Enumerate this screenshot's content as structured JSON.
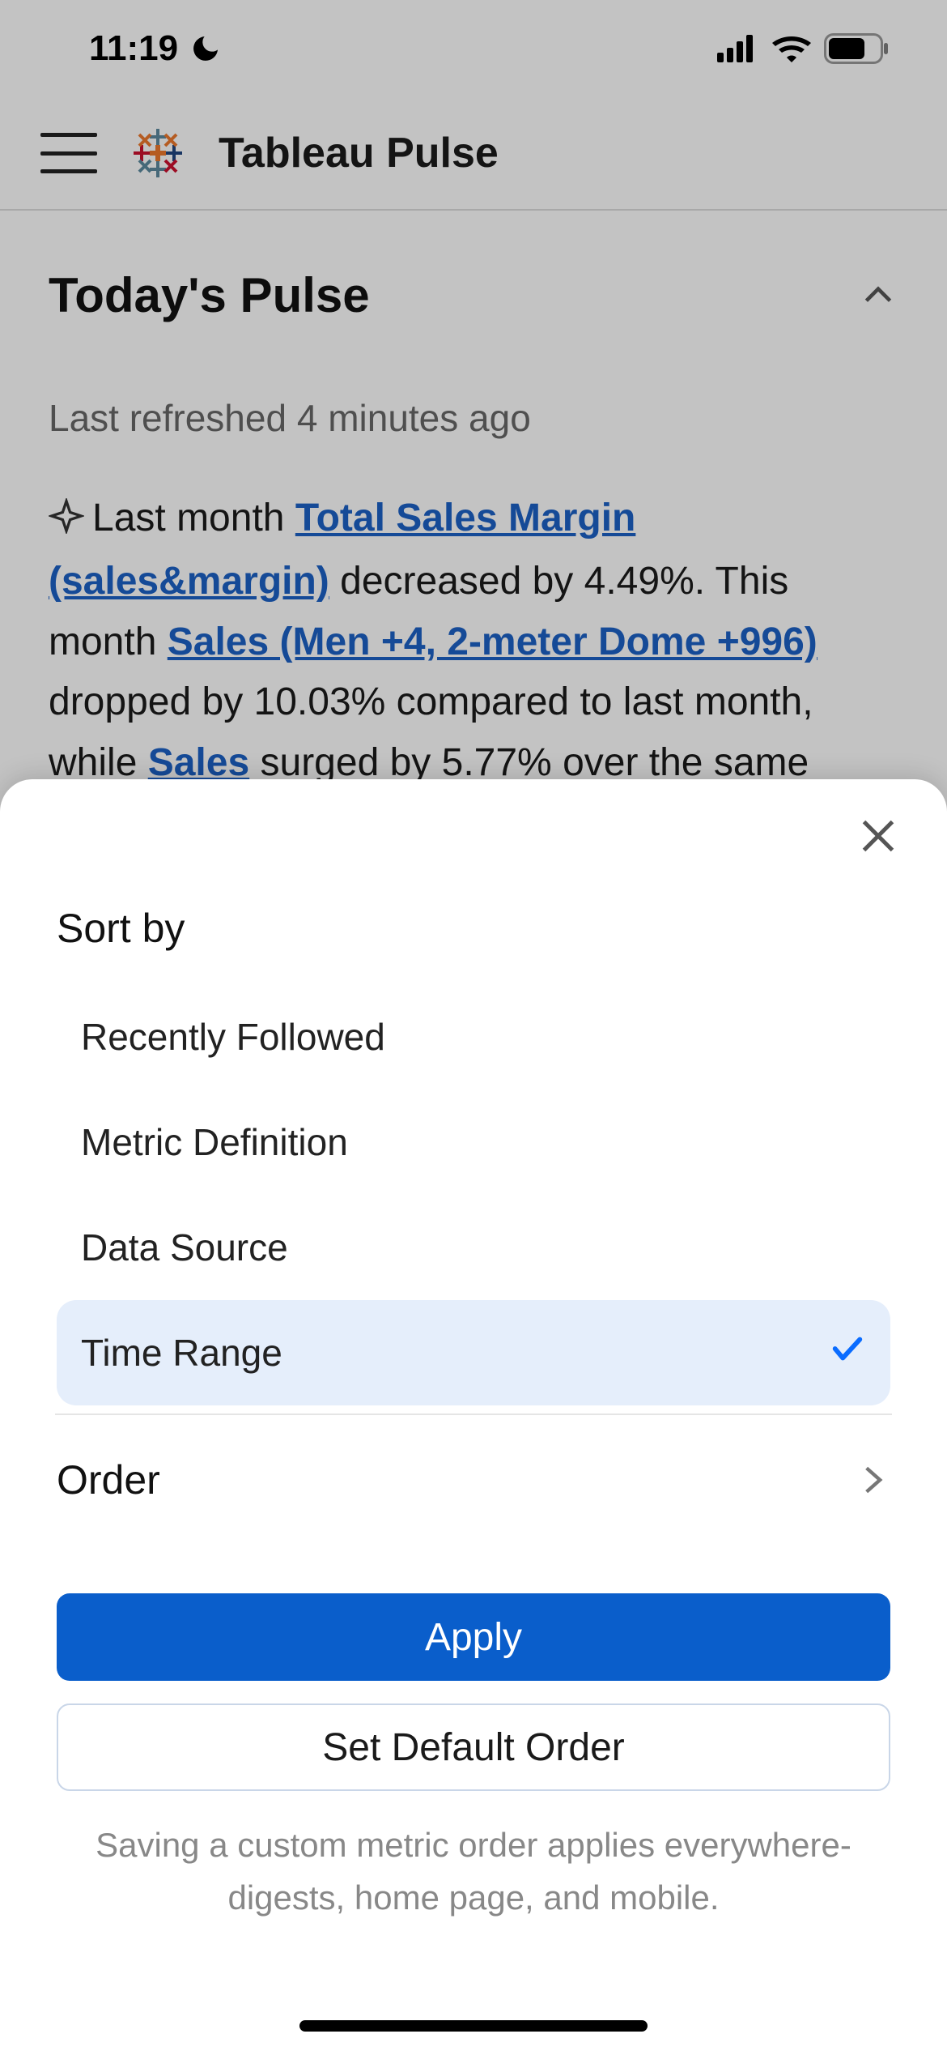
{
  "status": {
    "time": "11:19"
  },
  "header": {
    "title": "Tableau Pulse"
  },
  "pulse": {
    "title": "Today's Pulse",
    "refreshed": "Last refreshed 4 minutes ago",
    "insight": {
      "t1": "Last month ",
      "link1": "Total Sales Margin (sales&margin)",
      "t2": " decreased by 4.49%. This month ",
      "link2": "Sales (Men +4, 2-meter Dome +996)",
      "t3": " dropped by 10.03% compared to last month, while ",
      "link3": "Sales",
      "t4": " surged by 5.77% over the same"
    }
  },
  "sheet": {
    "title": "Sort by",
    "options": [
      {
        "label": "Recently Followed",
        "selected": false
      },
      {
        "label": "Metric Definition",
        "selected": false
      },
      {
        "label": "Data Source",
        "selected": false
      },
      {
        "label": "Time Range",
        "selected": true
      }
    ],
    "order_label": "Order",
    "apply_label": "Apply",
    "default_label": "Set Default Order",
    "note": "Saving a custom metric order applies everywhere- digests, home page, and mobile."
  },
  "colors": {
    "primary": "#0a5ecb",
    "link": "#1b5fc2",
    "selected_bg": "#e5eefb"
  }
}
